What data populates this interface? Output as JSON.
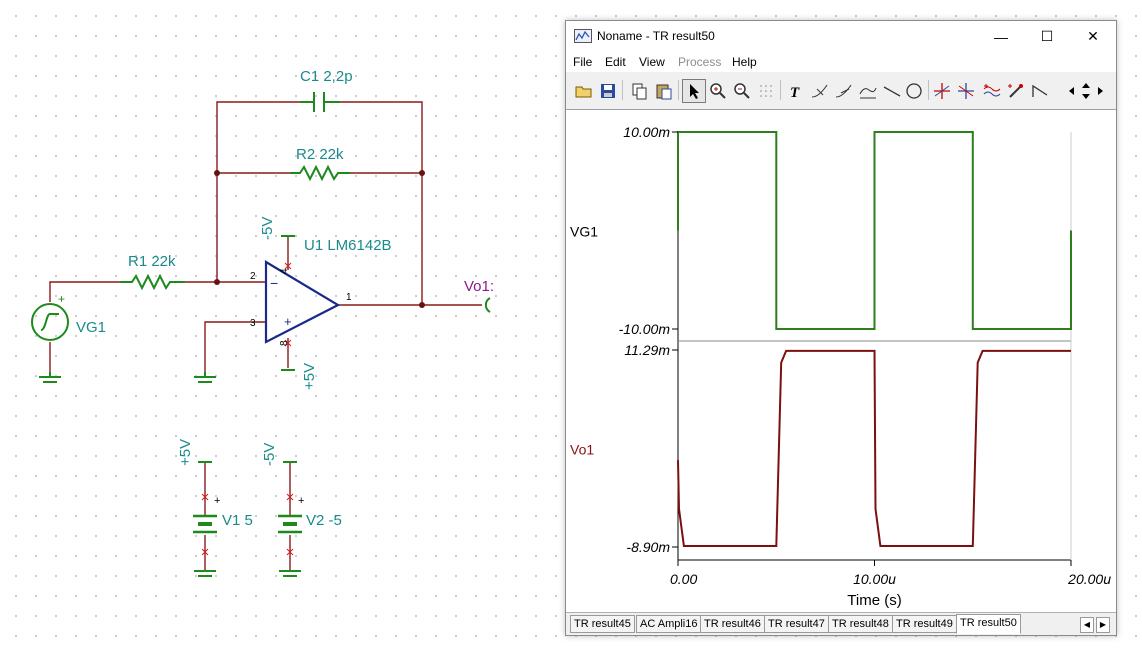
{
  "schematic": {
    "c1_label": "C1 2,2p",
    "r2_label": "R2 22k",
    "r1_label": "R1 22k",
    "u1_label": "U1 LM6142B",
    "vg1_label": "VG1",
    "vo1_label": "Vo1:",
    "v1_label": "V1 5",
    "v2_label": "V2 -5",
    "rail_minus": "-5V",
    "rail_plus": "+5V",
    "pin_1": "1",
    "pin_2": "2",
    "pin_3": "3",
    "pin_4": "4",
    "pin_8": "8",
    "plus_sign": "+",
    "minus_sign": "−"
  },
  "window": {
    "title": "Noname - TR result50",
    "controls": {
      "minimize": "—",
      "maximize": "☐",
      "close": "✕"
    },
    "menu": [
      "File",
      "Edit",
      "View",
      "Process",
      "Help"
    ],
    "toolbar_icons": [
      "open-icon",
      "save-icon",
      "copy-icon",
      "paste-icon",
      "pointer-icon",
      "zoom-in-icon",
      "zoom-out-icon",
      "grid-icon",
      "text-icon",
      "cursor-a-icon",
      "cursor-b-icon",
      "curve-icon",
      "line-icon",
      "circle-icon",
      "marker-a-icon",
      "marker-b-icon",
      "waves-icon",
      "probe-icon",
      "ramp-icon"
    ]
  },
  "chart_data": {
    "type": "line",
    "xlabel": "Time (s)",
    "x_ticks": [
      "0.00",
      "10.00u",
      "20.00u"
    ],
    "xlim": [
      0,
      20
    ],
    "panels": [
      {
        "name": "VG1",
        "y_top_label": "10.00m",
        "y_bottom_label": "-10.00m",
        "ylim": [
          -10,
          10
        ],
        "color": "#2e7d1e",
        "x": [
          0,
          0,
          5,
          5,
          10,
          10,
          15,
          15,
          20,
          20
        ],
        "y": [
          0,
          10,
          10,
          -10,
          -10,
          10,
          10,
          -10,
          -10,
          0
        ]
      },
      {
        "name": "Vo1",
        "y_top_label": "11.29m",
        "y_bottom_label": "-8.90m",
        "ylim": [
          -8.9,
          11.29
        ],
        "color": "#7a1010",
        "x": [
          0,
          0.05,
          0.3,
          5,
          5.25,
          5.5,
          10,
          10.05,
          10.3,
          15,
          15.25,
          15.5,
          20
        ],
        "y": [
          0,
          -5,
          -8.8,
          -8.8,
          10,
          11.2,
          11.2,
          -5,
          -8.8,
          -8.8,
          10,
          11.2,
          11.2
        ]
      }
    ]
  },
  "tabs": [
    "TR result45",
    "AC Ampli16",
    "TR result46",
    "TR result47",
    "TR result48",
    "TR result49",
    "TR result50"
  ],
  "active_tab": "TR result50"
}
